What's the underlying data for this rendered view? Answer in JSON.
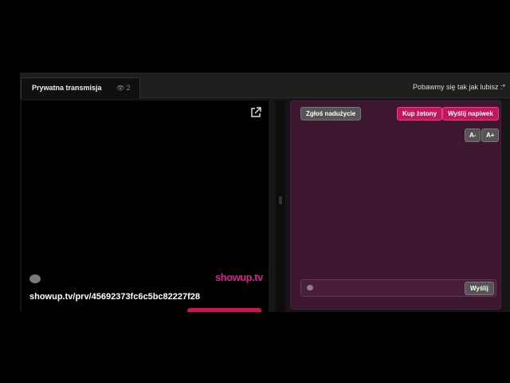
{
  "tab": {
    "title": "Prywatna transmisja",
    "viewers": "2",
    "eye_icon": "eye-icon"
  },
  "status": "Pobawmy się tak jak lubisz :*",
  "video": {
    "logo_text": "showup.tv",
    "url": "showup.tv/prv/45692373fc6c5bc82227f28"
  },
  "chat": {
    "report_label": "Zgłoś nadużycie",
    "buy_label": "Kup żetony",
    "tip_label": "Wyślij napiwek",
    "font_decrease": "A-",
    "font_increase": "A+",
    "input_value": "",
    "send_label": "Wyślij"
  },
  "colors": {
    "accent": "#c2185b",
    "chat_bg": "#3d1630"
  }
}
